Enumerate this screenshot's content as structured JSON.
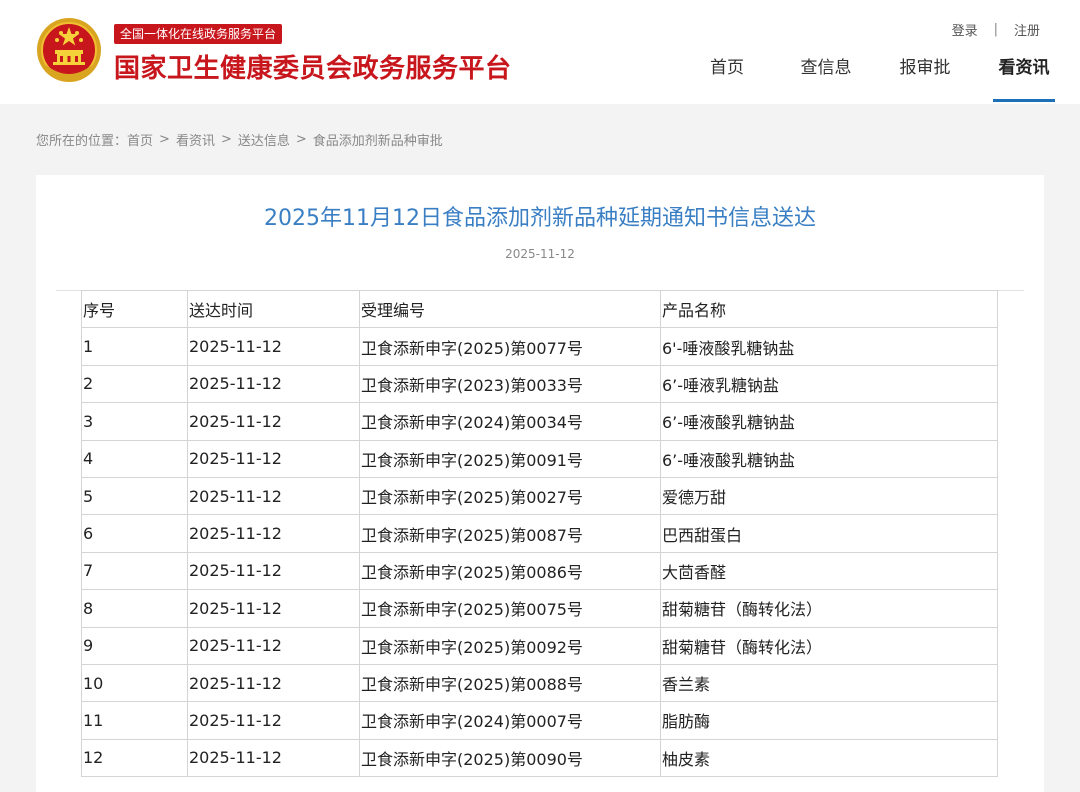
{
  "header": {
    "badge": "全国一体化在线政务服务平台",
    "site_title": "国家卫生健康委员会政务服务平台",
    "login": "登录",
    "separator": "|",
    "register": "注册",
    "nav": [
      {
        "label": "首页",
        "active": false
      },
      {
        "label": "查信息",
        "active": false
      },
      {
        "label": "报审批",
        "active": false
      },
      {
        "label": "看资讯",
        "active": true
      }
    ]
  },
  "breadcrumb": {
    "prefix": "您所在的位置：",
    "items": [
      "首页",
      "看资讯",
      "送达信息",
      "食品添加剂新品种审批"
    ],
    "arrow": ">"
  },
  "article": {
    "title": "2025年11月12日食品添加剂新品种延期通知书信息送达",
    "date": "2025-11-12"
  },
  "table": {
    "headers": [
      "序号",
      "送达时间",
      "受理编号",
      "产品名称"
    ],
    "rows": [
      [
        "1",
        "2025-11-12",
        "卫食添新申字(2025)第0077号",
        "6'-唾液酸乳糖钠盐"
      ],
      [
        "2",
        "2025-11-12",
        "卫食添新申字(2023)第0033号",
        "6’-唾液乳糖钠盐"
      ],
      [
        "3",
        "2025-11-12",
        "卫食添新申字(2024)第0034号",
        "6’-唾液酸乳糖钠盐"
      ],
      [
        "4",
        "2025-11-12",
        "卫食添新申字(2025)第0091号",
        "6’-唾液酸乳糖钠盐"
      ],
      [
        "5",
        "2025-11-12",
        "卫食添新申字(2025)第0027号",
        "爱德万甜"
      ],
      [
        "6",
        "2025-11-12",
        "卫食添新申字(2025)第0087号",
        "巴西甜蛋白"
      ],
      [
        "7",
        "2025-11-12",
        "卫食添新申字(2025)第0086号",
        "大茴香醛"
      ],
      [
        "8",
        "2025-11-12",
        "卫食添新申字(2025)第0075号",
        "甜菊糖苷（酶转化法）"
      ],
      [
        "9",
        "2025-11-12",
        "卫食添新申字(2025)第0092号",
        "甜菊糖苷（酶转化法）"
      ],
      [
        "10",
        "2025-11-12",
        "卫食添新申字(2025)第0088号",
        "香兰素"
      ],
      [
        "11",
        "2025-11-12",
        "卫食添新申字(2024)第0007号",
        "脂肪酶"
      ],
      [
        "12",
        "2025-11-12",
        "卫食添新申字(2025)第0090号",
        "柚皮素"
      ]
    ]
  },
  "colors": {
    "brand_red": "#c8161d",
    "title_blue": "#3a7fc4",
    "nav_underline": "#1d6fb8"
  }
}
